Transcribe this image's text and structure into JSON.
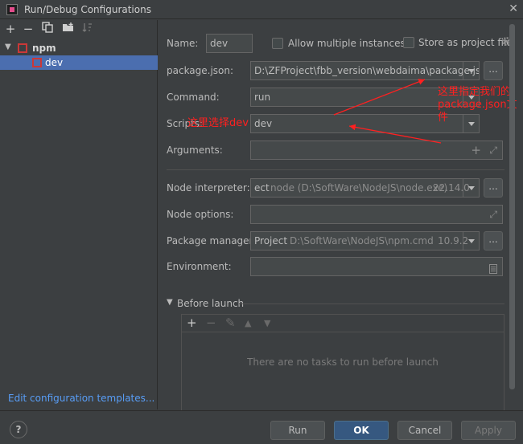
{
  "window": {
    "title": "Run/Debug Configurations"
  },
  "left_panel": {
    "tree": [
      {
        "label": "npm"
      },
      {
        "label": "dev"
      }
    ],
    "edit_templates_link": "Edit configuration templates..."
  },
  "form": {
    "name_label": "Name:",
    "name_value": "dev",
    "allow_multiple_label": "Allow multiple instances",
    "store_as_project_label": "Store as project file",
    "package_json_label": "package.json:",
    "package_json_value": "D:\\ZFProject\\fbb_version\\webdaima\\package.json",
    "command_label": "Command:",
    "command_value": "run",
    "scripts_label": "Scripts:",
    "scripts_value": "dev",
    "arguments_label": "Arguments:",
    "node_interpreter_label": "Node interpreter:",
    "node_interpreter_prefix": "ect",
    "node_interpreter_path": "node (D:\\SoftWare\\NodeJS\\node.exe)",
    "node_interpreter_version": "22.14.0",
    "node_options_label": "Node options:",
    "package_manager_label": "Package manager:",
    "package_manager_prefix": "Project",
    "package_manager_path": "D:\\SoftWare\\NodeJS\\npm.cmd",
    "package_manager_version": "10.9.2",
    "environment_label": "Environment:",
    "dots_label": "..."
  },
  "before_launch": {
    "title": "Before launch",
    "empty_text": "There are no tasks to run before launch"
  },
  "buttons": {
    "help": "?",
    "run": "Run",
    "ok": "OK",
    "cancel": "Cancel",
    "apply": "Apply"
  },
  "annotations": {
    "package_note_line1": "这里指定我们的",
    "package_note_line2": "package.json文",
    "package_note_line3": "件",
    "scripts_note": "这里选择dev"
  },
  "colors": {
    "background": "#3c3f41",
    "selection": "#4b6eaf",
    "ok_button": "#365880",
    "link": "#589df6",
    "annotation": "#ff2020"
  }
}
